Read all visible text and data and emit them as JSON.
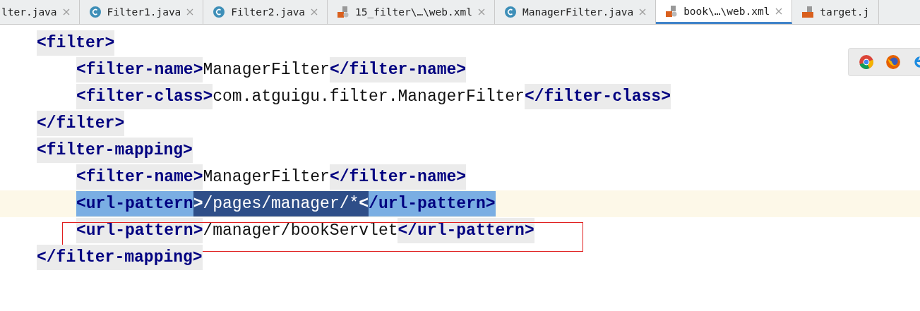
{
  "tabs": [
    {
      "label": "lter.java",
      "kind": "plain",
      "selected": false
    },
    {
      "label": "Filter1.java",
      "kind": "class",
      "selected": false
    },
    {
      "label": "Filter2.java",
      "kind": "class",
      "selected": false
    },
    {
      "label": "15_filter\\…\\web.xml",
      "kind": "xml",
      "selected": false
    },
    {
      "label": "ManagerFilter.java",
      "kind": "class",
      "selected": false
    },
    {
      "label": "book\\…\\web.xml",
      "kind": "xml",
      "selected": true
    },
    {
      "label": "target.j",
      "kind": "jsp",
      "selected": false
    }
  ],
  "code": [
    {
      "tokens": [
        {
          "kind": "tag",
          "text": "<filter>",
          "selected": false
        }
      ],
      "current": false,
      "boxed": false,
      "children": [
        {
          "tokens": [
            {
              "kind": "tag",
              "text": "<filter-name>",
              "selected": false
            },
            {
              "kind": "text",
              "text": "ManagerFilter",
              "selected": false
            },
            {
              "kind": "tag",
              "text": "</filter-name>",
              "selected": false
            }
          ],
          "current": false,
          "boxed": false
        },
        {
          "tokens": [
            {
              "kind": "tag",
              "text": "<filter-class>",
              "selected": false
            },
            {
              "kind": "text",
              "text": "com.atguigu.filter.ManagerFilter",
              "selected": false
            },
            {
              "kind": "tag",
              "text": "</filter-class>",
              "selected": false
            }
          ],
          "current": false,
          "boxed": false
        }
      ]
    },
    {
      "tokens": [
        {
          "kind": "tag",
          "text": "</filter>",
          "selected": false
        }
      ],
      "current": false,
      "boxed": false
    },
    {
      "tokens": [
        {
          "kind": "tag",
          "text": "<filter-mapping>",
          "selected": false
        }
      ],
      "current": false,
      "boxed": false,
      "children": [
        {
          "tokens": [
            {
              "kind": "tag",
              "text": "<filter-name>",
              "selected": false
            },
            {
              "kind": "text",
              "text": "ManagerFilter",
              "selected": false
            },
            {
              "kind": "tag",
              "text": "</filter-name>",
              "selected": false
            }
          ],
          "current": false,
          "boxed": false
        },
        {
          "tokens": [
            {
              "kind": "tag",
              "text": "<url-pattern",
              "selected": false
            },
            {
              "kind": "tag",
              "text": ">",
              "selected": true
            },
            {
              "kind": "text",
              "text": "/pages/manager/*",
              "selected": true
            },
            {
              "kind": "tag",
              "text": "<",
              "selected": true
            },
            {
              "kind": "tag",
              "text": "/url-pattern>",
              "selected": false
            }
          ],
          "current": true,
          "boxed": false
        },
        {
          "tokens": [
            {
              "kind": "tag",
              "text": "<url-pattern>",
              "selected": false
            },
            {
              "kind": "text",
              "text": "/manager/bookServlet",
              "selected": false
            },
            {
              "kind": "tag",
              "text": "</url-pattern>",
              "selected": false
            }
          ],
          "current": false,
          "boxed": true
        }
      ]
    },
    {
      "tokens": [
        {
          "kind": "tag",
          "text": "</filter-mapping>",
          "selected": false
        }
      ],
      "current": false,
      "boxed": false
    }
  ]
}
